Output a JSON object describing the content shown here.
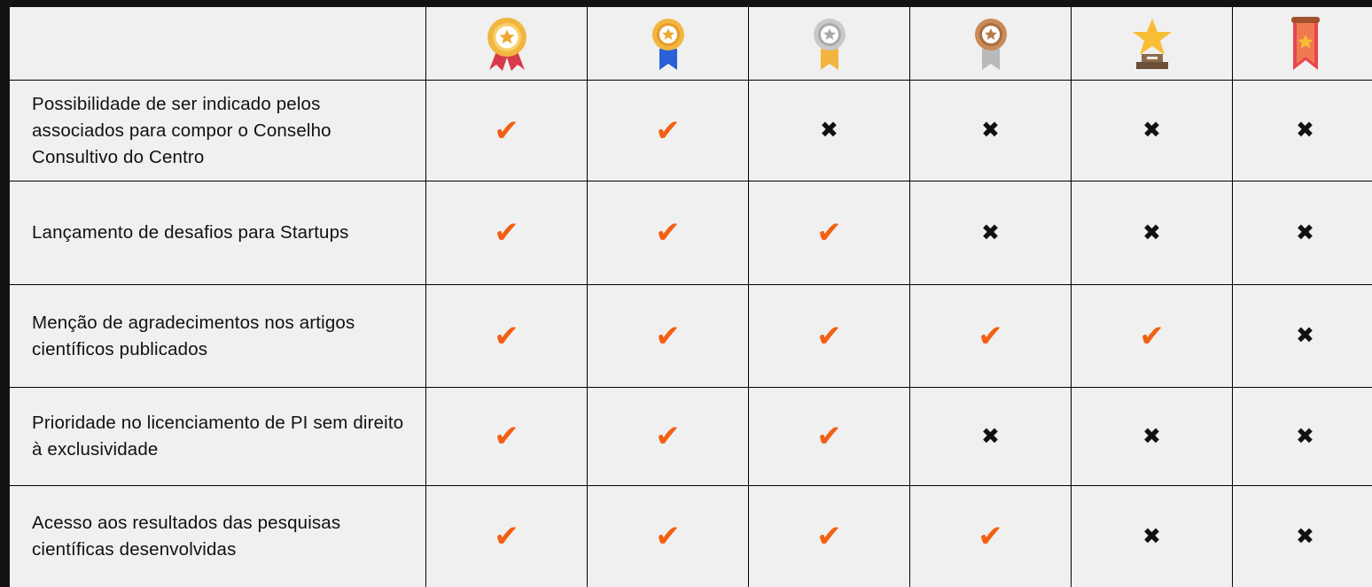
{
  "table": {
    "header": {
      "corner": "",
      "tiers": [
        {
          "icon": "rosette-gold-red-ribbon-icon"
        },
        {
          "icon": "medal-gold-blue-ribbon-icon"
        },
        {
          "icon": "medal-silver-yellow-ribbon-icon"
        },
        {
          "icon": "medal-bronze-grey-ribbon-icon"
        },
        {
          "icon": "star-trophy-icon"
        },
        {
          "icon": "red-banner-star-icon"
        }
      ]
    },
    "rows": [
      {
        "label": "Possibilidade de ser indicado pelos associados para compor o Conselho Consultivo do Centro",
        "cells": [
          {
            "icon": "check-icon",
            "glyph": "✔"
          },
          {
            "icon": "check-icon",
            "glyph": "✔"
          },
          {
            "icon": "cross-icon",
            "glyph": "✖"
          },
          {
            "icon": "cross-icon",
            "glyph": "✖"
          },
          {
            "icon": "cross-icon",
            "glyph": "✖"
          },
          {
            "icon": "cross-icon",
            "glyph": "✖"
          }
        ]
      },
      {
        "label": "Lançamento de desafios para Startups",
        "cells": [
          {
            "icon": "check-icon",
            "glyph": "✔"
          },
          {
            "icon": "check-icon",
            "glyph": "✔"
          },
          {
            "icon": "check-icon",
            "glyph": "✔"
          },
          {
            "icon": "cross-icon",
            "glyph": "✖"
          },
          {
            "icon": "cross-icon",
            "glyph": "✖"
          },
          {
            "icon": "cross-icon",
            "glyph": "✖"
          }
        ]
      },
      {
        "label": "Menção de agradecimentos nos artigos científicos publicados",
        "cells": [
          {
            "icon": "check-icon",
            "glyph": "✔"
          },
          {
            "icon": "check-icon",
            "glyph": "✔"
          },
          {
            "icon": "check-icon",
            "glyph": "✔"
          },
          {
            "icon": "check-icon",
            "glyph": "✔"
          },
          {
            "icon": "check-icon",
            "glyph": "✔"
          },
          {
            "icon": "cross-icon",
            "glyph": "✖"
          }
        ]
      },
      {
        "label": "Prioridade no licenciamento de PI sem direito à exclusividade",
        "cells": [
          {
            "icon": "check-icon",
            "glyph": "✔"
          },
          {
            "icon": "check-icon",
            "glyph": "✔"
          },
          {
            "icon": "check-icon",
            "glyph": "✔"
          },
          {
            "icon": "cross-icon",
            "glyph": "✖"
          },
          {
            "icon": "cross-icon",
            "glyph": "✖"
          },
          {
            "icon": "cross-icon",
            "glyph": "✖"
          }
        ]
      },
      {
        "label": "Acesso aos resultados das pesquisas científicas desenvolvidas",
        "cells": [
          {
            "icon": "check-icon",
            "glyph": "✔"
          },
          {
            "icon": "check-icon",
            "glyph": "✔"
          },
          {
            "icon": "check-icon",
            "glyph": "✔"
          },
          {
            "icon": "check-icon",
            "glyph": "✔"
          },
          {
            "icon": "cross-icon",
            "glyph": "✖"
          },
          {
            "icon": "cross-icon",
            "glyph": "✖"
          }
        ]
      }
    ]
  },
  "colors": {
    "check": "#f26014",
    "cross": "#111111",
    "cell_bg": "#f0f0f0",
    "border": "#000000",
    "page_bg": "#121212"
  }
}
